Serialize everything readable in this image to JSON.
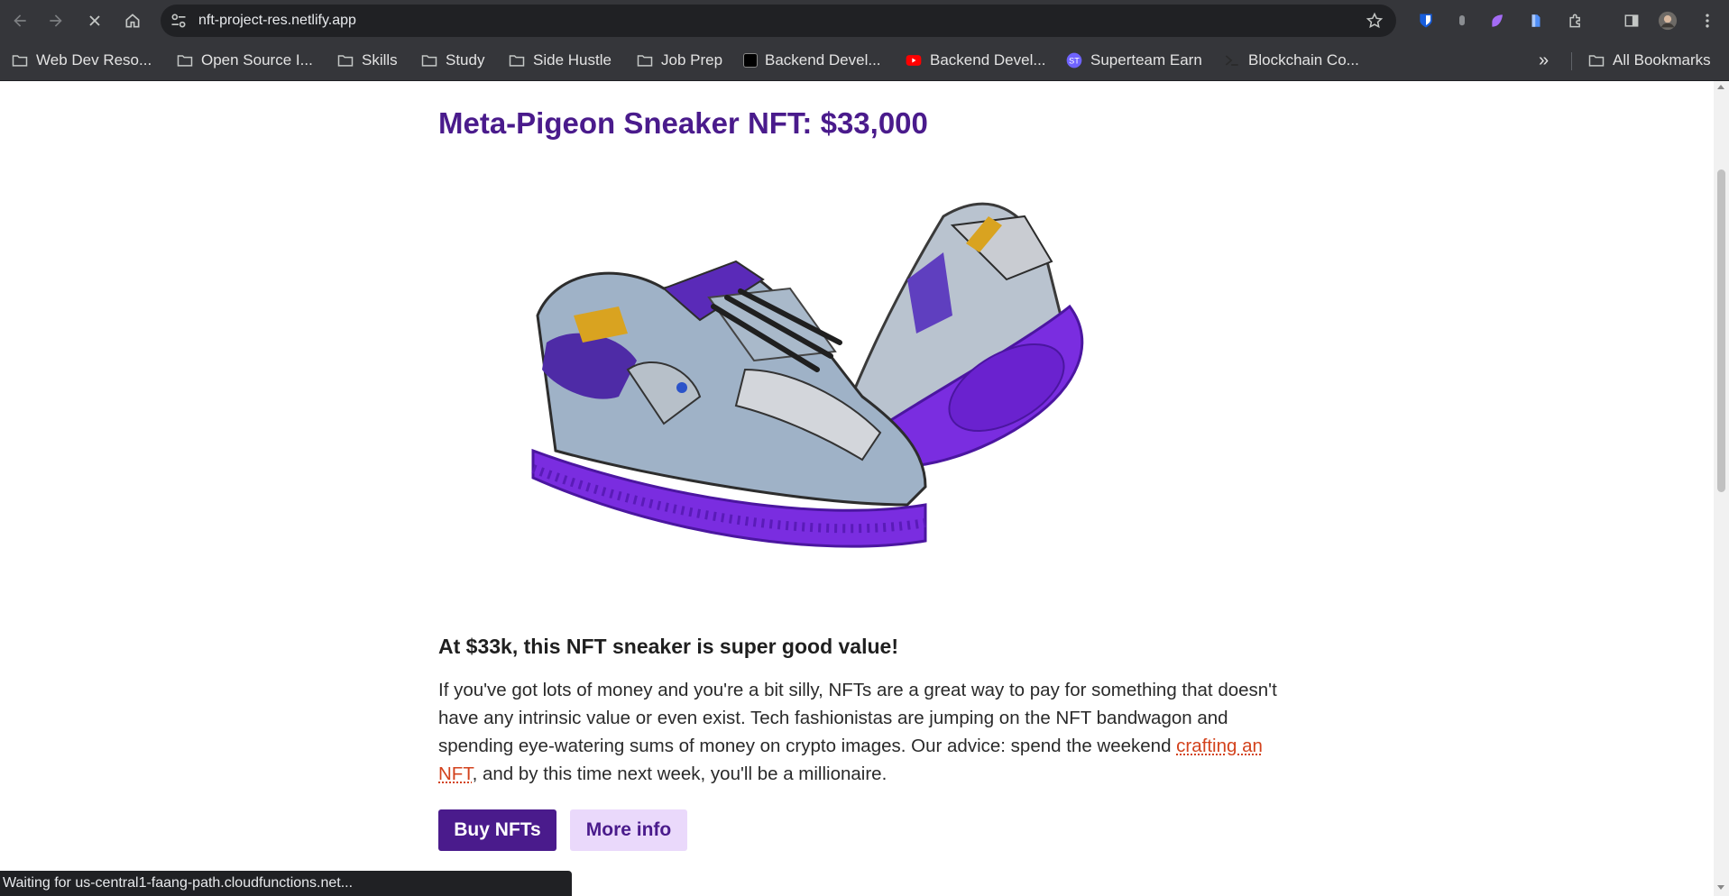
{
  "browser": {
    "url": "nft-project-res.netlify.app",
    "bookmarks": [
      {
        "label": "Web Dev Reso...",
        "icon": "folder-icon"
      },
      {
        "label": "Open Source I...",
        "icon": "folder-icon"
      },
      {
        "label": "Skills",
        "icon": "folder-icon"
      },
      {
        "label": "Study",
        "icon": "folder-icon"
      },
      {
        "label": "Side Hustle",
        "icon": "folder-icon"
      },
      {
        "label": "Job Prep",
        "icon": "folder-icon"
      },
      {
        "label": "Backend Devel...",
        "icon": "site-favicon"
      },
      {
        "label": "Backend Devel...",
        "icon": "youtube-icon"
      },
      {
        "label": "Superteam Earn",
        "icon": "superteam-icon"
      },
      {
        "label": "Blockchain Co...",
        "icon": "site-favicon"
      }
    ],
    "more_bookmarks": "»",
    "all_bookmarks": "All Bookmarks",
    "status": "Waiting for us-central1-faang-path.cloudfunctions.net..."
  },
  "page": {
    "title": "Meta-Pigeon Sneaker NFT: $33,000",
    "subhead": "At $33k, this NFT sneaker is super good value!",
    "body_pre": "If you've got lots of money and you're a bit silly, NFTs are a great way to pay for something that doesn't have any intrinsic value or even exist. Tech fashionistas are jumping on the NFT bandwagon and spending eye-watering sums of money on crypto images. Our advice: spend the weekend ",
    "body_link": "crafting an NFT",
    "body_post": ", and by this time next week, you'll be a millionaire.",
    "buy_button": "Buy NFTs",
    "more_button": "More info"
  },
  "colors": {
    "brand_purple": "#4a1b8c",
    "button_light": "#ead9fb",
    "link": "#d3421c"
  }
}
